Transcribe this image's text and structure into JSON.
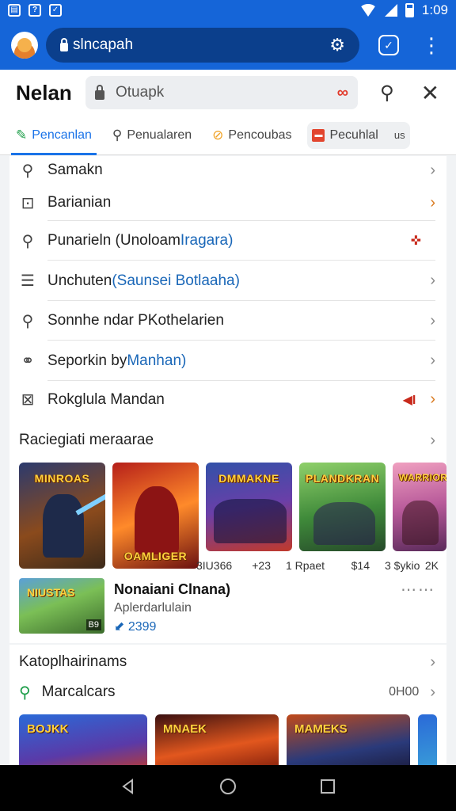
{
  "status": {
    "time": "1:09"
  },
  "browser": {
    "url": "slncapah"
  },
  "header": {
    "brand": "Nelan",
    "search_value": "Otuapk"
  },
  "tabs": [
    {
      "label": "Pencanlan",
      "icon": "pencil-icon",
      "active": true
    },
    {
      "label": "Penualaren",
      "icon": "search-icon",
      "active": false
    },
    {
      "label": "Pencoubas",
      "icon": "coin-icon",
      "active": false
    },
    {
      "label": "Pecuhlal",
      "suffix": "us",
      "icon": "red-app-icon",
      "active": false
    }
  ],
  "menu": [
    {
      "icon": "search-icon",
      "label": "Samakn",
      "highlight": ""
    },
    {
      "icon": "box-icon",
      "label": "Barianian",
      "highlight": ""
    },
    {
      "icon": "zoom-icon",
      "label": "Punarieln (Unoloam ",
      "highlight": "Iragara)",
      "badge": "✜"
    },
    {
      "icon": "list-icon",
      "label": "Unchuten ",
      "highlight": "(Saunsei Botlaaha)"
    },
    {
      "icon": "search-icon",
      "label": "Sonnhe ndar PKothelarien",
      "highlight": ""
    },
    {
      "icon": "tag-icon",
      "label": "Seporkin by ",
      "highlight": "Manhan)"
    },
    {
      "icon": "image-icon",
      "label": "Rokglula Mandan",
      "highlight": "",
      "badge": "◀I"
    }
  ],
  "games": {
    "title": "Raciegiati meraarae",
    "thumbs": [
      {
        "title": "MINROAS",
        "left": "",
        "right": ""
      },
      {
        "title": "OAMLIGER",
        "left": "",
        "right": ""
      },
      {
        "title": "DMMAKNE",
        "left": "3IU366",
        "right": "+23"
      },
      {
        "title": "PLANDKRAN",
        "left": "1 Rpaet",
        "right": "$14"
      },
      {
        "title": "WARRIOR",
        "left": "3 $ykio",
        "right": "2K"
      }
    ],
    "featured": {
      "name": "Nonaiani Clnana)",
      "developer": "Aplerdarlulain",
      "stat": "2399",
      "tag": "B9"
    }
  },
  "categories": {
    "title": "Katoplhairinams",
    "row_label": "Marcalcars",
    "row_count": "0H00",
    "thumbs": [
      "BOJKK",
      "MNAEK",
      "MAMEKS"
    ]
  }
}
